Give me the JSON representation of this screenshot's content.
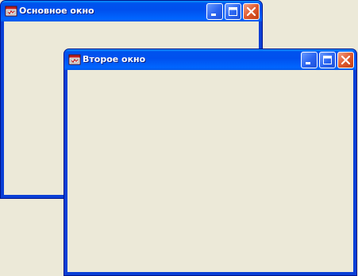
{
  "windows": [
    {
      "title": "Основное окно",
      "icon": "app-icon",
      "buttons": [
        "minimize",
        "maximize",
        "close"
      ]
    },
    {
      "title": "Второе окно",
      "icon": "app-icon",
      "buttons": [
        "minimize",
        "maximize",
        "close"
      ]
    }
  ],
  "colors": {
    "desktop": "#ECE9D8",
    "titlebar": "#0050EE",
    "window_frame": "#0A3FD6",
    "close_button": "#E05A2E",
    "client_area": "#ECE9D8"
  }
}
